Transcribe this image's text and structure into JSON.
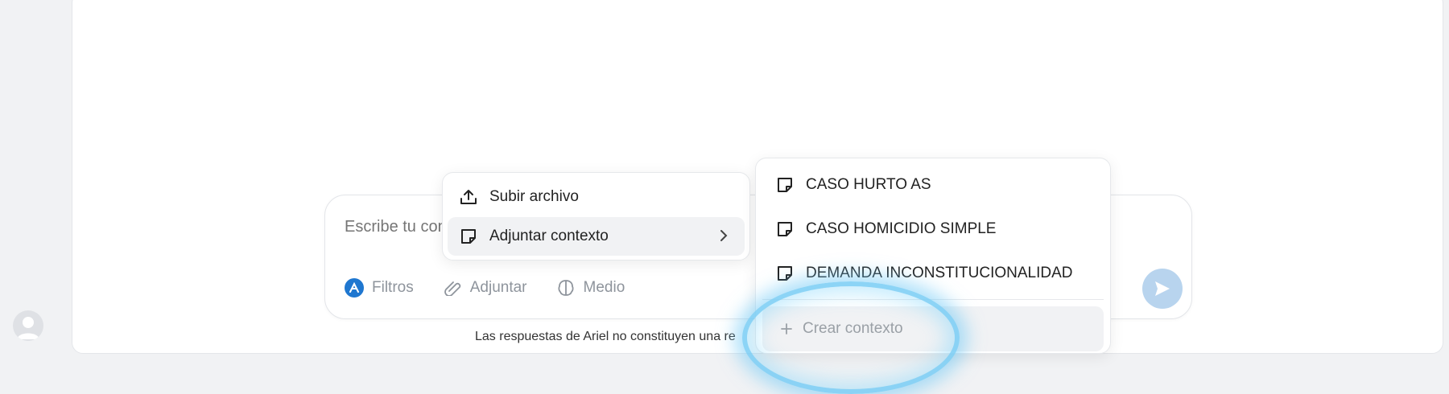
{
  "sidebar": {
    "avatar_icon": "user-avatar-icon"
  },
  "composer": {
    "placeholder": "Escribe tu consulta...",
    "visible_placeholder": "Escribe tu c",
    "tools": [
      {
        "label": "Filtros",
        "icon": "filter-logo-icon"
      },
      {
        "label": "Adjuntar",
        "icon": "paperclip-icon"
      },
      {
        "label": "Medio",
        "icon": "brain-icon"
      }
    ],
    "send_icon": "send-icon"
  },
  "attach_menu": {
    "items": [
      {
        "label": "Subir archivo",
        "icon": "upload-icon"
      },
      {
        "label": "Adjuntar contexto",
        "icon": "note-icon",
        "has_submenu": true
      }
    ]
  },
  "context_menu": {
    "items": [
      {
        "label": "CASO HURTO AS",
        "icon": "note-icon"
      },
      {
        "label": "CASO HOMICIDIO SIMPLE",
        "icon": "note-icon"
      },
      {
        "label": "DEMANDA INCONSTITUCIONALIDAD",
        "icon": "note-icon"
      }
    ],
    "create_label": "Crear contexto"
  },
  "footer": {
    "disclaimer": "Las respuestas de Ariel no constituyen una re"
  },
  "colors": {
    "accent": "#1f77d0",
    "send_disabled": "#b8d4ee",
    "highlight_glow": "#6ec8f5"
  }
}
